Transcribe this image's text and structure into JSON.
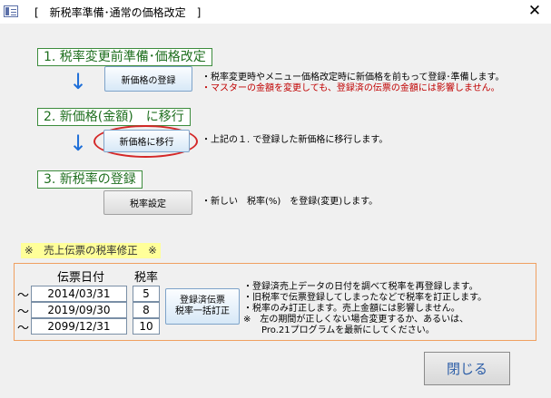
{
  "window": {
    "title": "[　新税率準備･通常の価格改定　]",
    "close_glyph": "✕"
  },
  "steps": [
    {
      "heading": "1. 税率変更前準備･価格改定",
      "button": "新価格の登録",
      "notes": [
        "・税率変更時やメニュー価格改定時に新価格を前もって登録･準備します。",
        "・マスターの金額を変更しても、登録済の伝票の金額には影響しません。"
      ]
    },
    {
      "heading": "2. 新価格(金額)　に移行",
      "button": "新価格に移行",
      "notes": [
        "・上記の１. で登録した新価格に移行します。"
      ]
    },
    {
      "heading": "3. 新税率の登録",
      "button": "税率設定",
      "notes": [
        "・新しい　税率(%)　を登録(変更)します。"
      ]
    }
  ],
  "correction": {
    "label": "※　売上伝票の税率修正　※",
    "col_date": "伝票日付",
    "col_rate": "税率",
    "tilde": "〜",
    "rows": [
      {
        "date": "2014/03/31",
        "rate": "5"
      },
      {
        "date": "2019/09/30",
        "rate": "8"
      },
      {
        "date": "2099/12/31",
        "rate": "10"
      }
    ],
    "button_line1": "登録済伝票",
    "button_line2": "税率一括訂正",
    "notes": [
      "・登録済売上データの日付を調べて税率を再登録します。",
      "・旧税率で伝票登録してしまったなどで税率を訂正します。",
      "・税率のみ訂正します。売上金額には影響しません。",
      "※　左の期間が正しくない場合変更するか、あるいは、",
      "　　Pro.21プログラムを最新にしてください。"
    ]
  },
  "close_button": "閉じる",
  "colors": {
    "step_border": "#3c8c3c",
    "step_text": "#1f6f1f",
    "arrow": "#1e6fd8",
    "note_red": "#c00000",
    "highlight_oval": "#d42828",
    "label_bg": "#ffff99",
    "panel_border": "#f0a060"
  }
}
